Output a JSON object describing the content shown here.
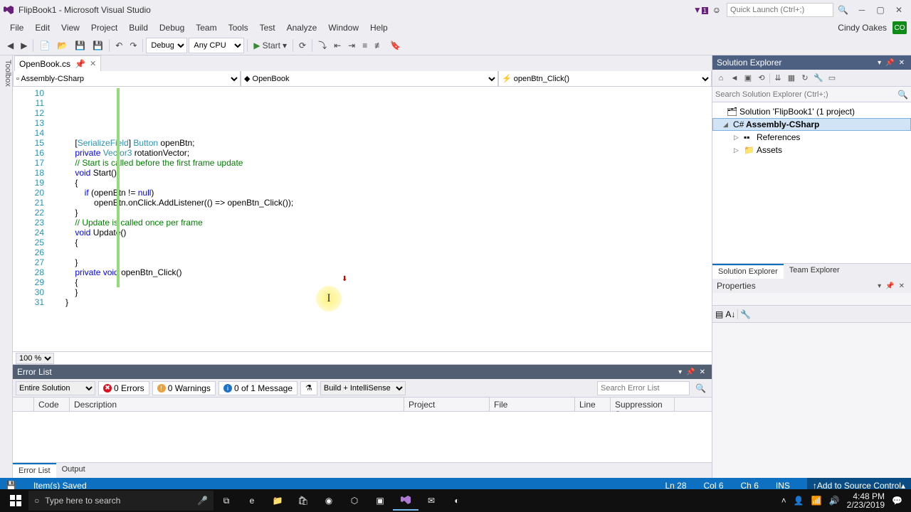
{
  "window": {
    "title": "FlipBook1 - Microsoft Visual Studio",
    "quick_launch_placeholder": "Quick Launch (Ctrl+;)",
    "user_name": "Cindy Oakes",
    "user_initials": "CO",
    "notifications_label": "Notifications"
  },
  "menu": {
    "items": [
      "File",
      "Edit",
      "View",
      "Project",
      "Build",
      "Debug",
      "Team",
      "Tools",
      "Test",
      "Analyze",
      "Window",
      "Help"
    ]
  },
  "toolbar": {
    "config": "Debug",
    "platform": "Any CPU",
    "start_label": "Start"
  },
  "toolbox_label": "Toolbox",
  "editor": {
    "file_tab": "OpenBook.cs",
    "nav_project": "Assembly-CSharp",
    "nav_class": "OpenBook",
    "nav_member": "openBtn_Click()",
    "zoom": "100 %",
    "first_line_no": 10,
    "lines": [
      {
        "indent": 1,
        "tokens": [
          {
            "t": "[",
            "c": ""
          },
          {
            "t": "SerializeField",
            "c": "type"
          },
          {
            "t": "] ",
            "c": ""
          },
          {
            "t": "Button",
            "c": "type"
          },
          {
            "t": " openBtn;",
            "c": ""
          }
        ]
      },
      {
        "indent": 0,
        "tokens": []
      },
      {
        "indent": 1,
        "tokens": [
          {
            "t": "private ",
            "c": "kw"
          },
          {
            "t": "Vector3",
            "c": "type"
          },
          {
            "t": " rotationVector;",
            "c": ""
          }
        ]
      },
      {
        "indent": 0,
        "tokens": []
      },
      {
        "indent": 1,
        "tokens": [
          {
            "t": "// Start is called before the first frame update",
            "c": "cmt"
          }
        ]
      },
      {
        "indent": 1,
        "tokens": [
          {
            "t": "void ",
            "c": "kw"
          },
          {
            "t": "Start()",
            "c": ""
          }
        ]
      },
      {
        "indent": 1,
        "tokens": [
          {
            "t": "{",
            "c": ""
          }
        ]
      },
      {
        "indent": 2,
        "tokens": [
          {
            "t": "if ",
            "c": "kw"
          },
          {
            "t": "(openBtn != ",
            "c": ""
          },
          {
            "t": "null",
            "c": "kw"
          },
          {
            "t": ")",
            "c": ""
          }
        ]
      },
      {
        "indent": 3,
        "tokens": [
          {
            "t": "openBtn.onClick.AddListener(() => openBtn_Click());",
            "c": ""
          }
        ]
      },
      {
        "indent": 1,
        "tokens": [
          {
            "t": "}",
            "c": ""
          }
        ]
      },
      {
        "indent": 0,
        "tokens": []
      },
      {
        "indent": 1,
        "tokens": [
          {
            "t": "// Update is called once per frame",
            "c": "cmt"
          }
        ]
      },
      {
        "indent": 1,
        "tokens": [
          {
            "t": "void ",
            "c": "kw"
          },
          {
            "t": "Update()",
            "c": ""
          }
        ]
      },
      {
        "indent": 1,
        "tokens": [
          {
            "t": "{",
            "c": ""
          }
        ]
      },
      {
        "indent": 2,
        "tokens": []
      },
      {
        "indent": 1,
        "tokens": [
          {
            "t": "}",
            "c": ""
          }
        ]
      },
      {
        "indent": 0,
        "tokens": []
      },
      {
        "indent": 1,
        "tokens": [
          {
            "t": "private ",
            "c": "kw"
          },
          {
            "t": "void ",
            "c": "kw"
          },
          {
            "t": "openBtn_Click()",
            "c": ""
          }
        ]
      },
      {
        "indent": 1,
        "tokens": [
          {
            "t": "{",
            "c": ""
          }
        ]
      },
      {
        "indent": 1,
        "tokens": [
          {
            "t": "}",
            "c": ""
          }
        ]
      },
      {
        "indent": 0,
        "tokens": [
          {
            "t": "}",
            "c": ""
          }
        ]
      },
      {
        "indent": 0,
        "tokens": []
      }
    ]
  },
  "solution_explorer": {
    "title": "Solution Explorer",
    "search_placeholder": "Search Solution Explorer (Ctrl+;)",
    "solution": "Solution 'FlipBook1' (1 project)",
    "project": "Assembly-CSharp",
    "ref": "References",
    "assets": "Assets",
    "tabs": [
      "Solution Explorer",
      "Team Explorer"
    ]
  },
  "properties": {
    "title": "Properties"
  },
  "error_list": {
    "title": "Error List",
    "scope": "Entire Solution",
    "errors": "0 Errors",
    "warnings": "0 Warnings",
    "messages": "0 of 1 Message",
    "build_combo": "Build + IntelliSense",
    "search_placeholder": "Search Error List",
    "cols": [
      "",
      "Code",
      "Description",
      "Project",
      "File",
      "Line",
      "Suppression St..."
    ],
    "tabs": [
      "Error List",
      "Output"
    ]
  },
  "status": {
    "msg": "Item(s) Saved",
    "line": "Ln 28",
    "col": "Col 6",
    "ch": "Ch 6",
    "ins": "INS",
    "src_ctrl": "Add to Source Control"
  },
  "taskbar": {
    "search_placeholder": "Type here to search",
    "time": "4:48 PM",
    "date": "2/23/2019"
  }
}
